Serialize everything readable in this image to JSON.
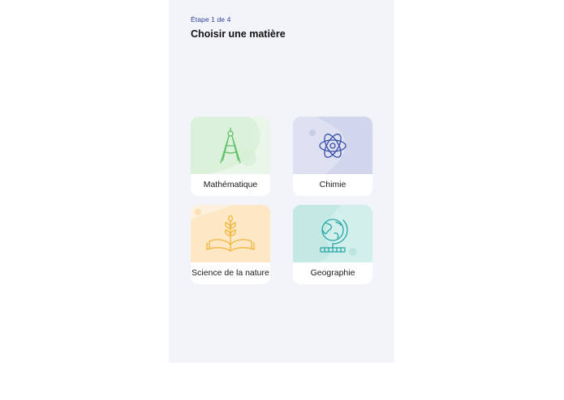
{
  "header": {
    "step_label": "Étape 1 de 4",
    "title": "Choisir une matière"
  },
  "subjects": [
    {
      "label": "Mathématique",
      "icon": "compass-icon",
      "color": "#5fc16b",
      "bg": "#dff2de"
    },
    {
      "label": "Chimie",
      "icon": "atom-icon",
      "color": "#3a4ea8",
      "bg": "#d3d8ee"
    },
    {
      "label": "Science de la nature",
      "icon": "book-plant-icon",
      "color": "#f2b53b",
      "bg": "#fde8c6"
    },
    {
      "label": "Geographie",
      "icon": "globe-icon",
      "color": "#27a7a4",
      "bg": "#c6ebe7"
    }
  ],
  "colors": {
    "accent": "#2b3f9c",
    "panel_bg": "#f3f4fa"
  }
}
